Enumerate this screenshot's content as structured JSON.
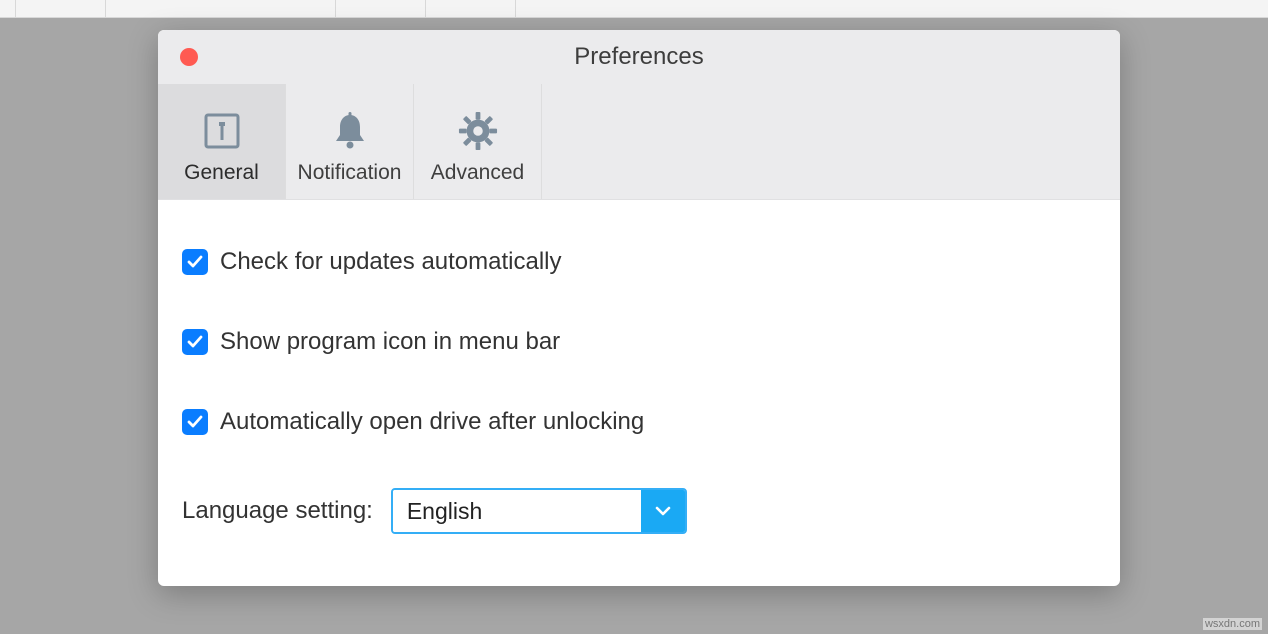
{
  "window": {
    "title": "Preferences"
  },
  "tabs": {
    "general": "General",
    "notification": "Notification",
    "advanced": "Advanced"
  },
  "options": {
    "check_updates": "Check for updates automatically",
    "show_icon": "Show program icon in menu bar",
    "auto_open": "Automatically open drive after unlocking"
  },
  "language": {
    "label": "Language setting:",
    "value": "English"
  },
  "watermark": "wsxdn.com"
}
